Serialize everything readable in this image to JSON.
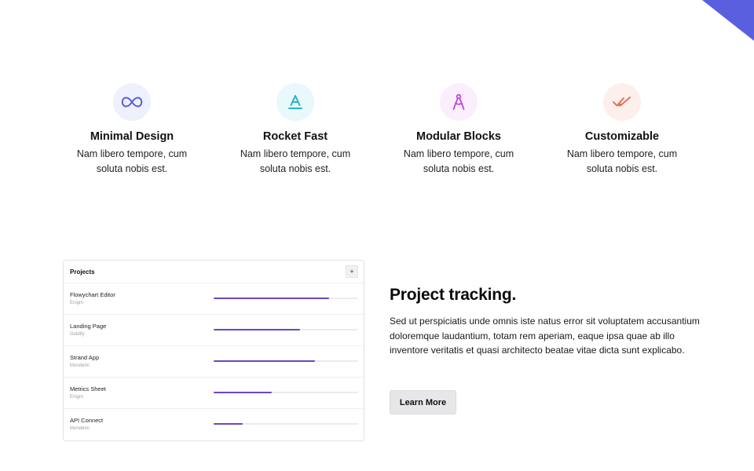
{
  "colors": {
    "accent": "#5a5fe0",
    "progress": "#6b46c1"
  },
  "features": [
    {
      "icon": "infinity-icon",
      "icon_color": "#5a5fd6",
      "bg_color": "#eef0fd",
      "title": "Minimal Design",
      "text": "Nam libero tempore, cum soluta nobis est."
    },
    {
      "icon": "text-underline-icon",
      "icon_color": "#2ab3cf",
      "bg_color": "#e8f8fb",
      "title": "Rocket Fast",
      "text": "Nam libero tempore, cum soluta nobis est."
    },
    {
      "icon": "compass-icon",
      "icon_color": "#c443d8",
      "bg_color": "#fbeefd",
      "title": "Modular Blocks",
      "text": "Nam libero tempore, cum soluta nobis est."
    },
    {
      "icon": "double-check-icon",
      "icon_color": "#e0775a",
      "bg_color": "#fdf0ec",
      "title": "Customizable",
      "text": "Nam libero tempore, cum soluta nobis est."
    }
  ],
  "projects": {
    "title": "Projects",
    "add_label": "+",
    "rows": [
      {
        "name": "Flowychart Editor",
        "owner": "Enigm",
        "progress": 0.8
      },
      {
        "name": "Landing Page",
        "owner": "Goldify",
        "progress": 0.6
      },
      {
        "name": "Strand App",
        "owner": "Mondemi",
        "progress": 0.7
      },
      {
        "name": "Metrics Sheet",
        "owner": "Enigm",
        "progress": 0.4
      },
      {
        "name": "API Connect",
        "owner": "Mondemi",
        "progress": 0.2
      }
    ]
  },
  "tracking": {
    "heading": "Project tracking.",
    "body": "Sed ut perspiciatis unde omnis iste natus error sit voluptatem accusantium doloremque laudantium, totam rem aperiam, eaque ipsa quae ab illo inventore veritatis et quasi architecto beatae vitae dicta sunt explicabo.",
    "button_label": "Learn More"
  }
}
